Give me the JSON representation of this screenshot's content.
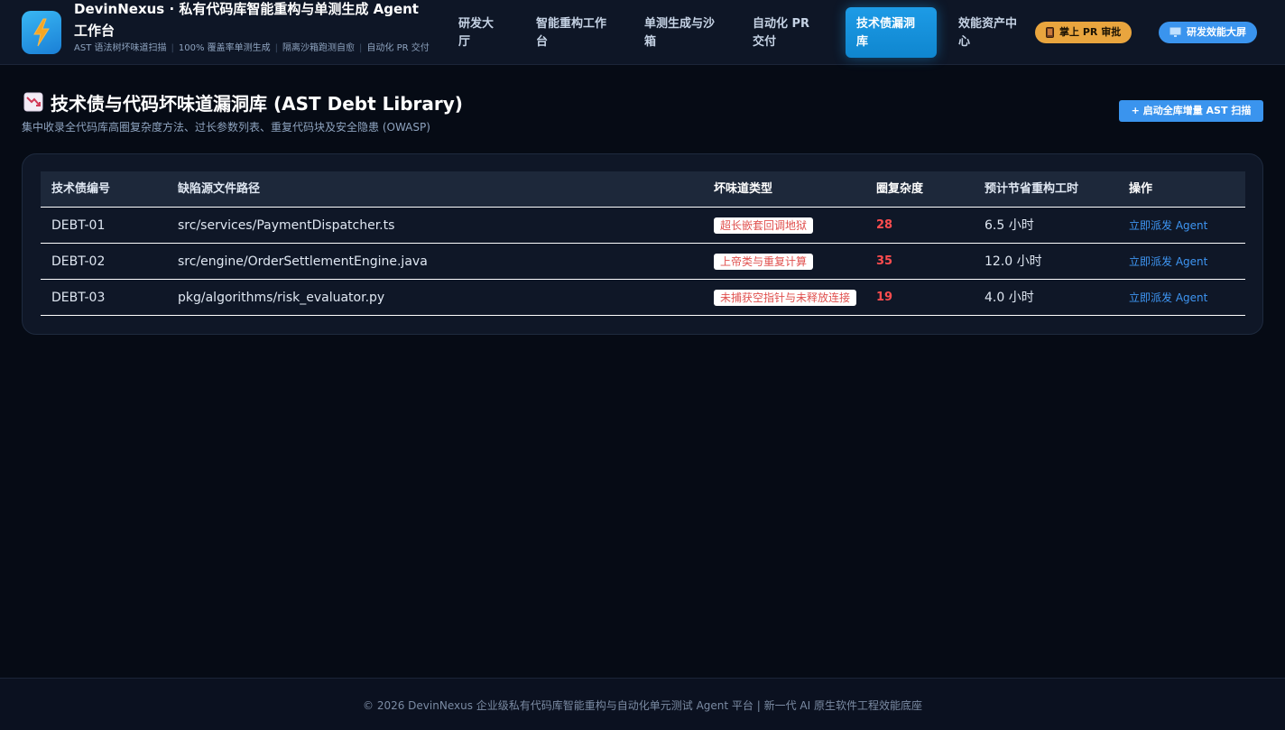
{
  "app": {
    "title": "DevinNexus · 私有代码库智能重构与单测生成 Agent 工作台",
    "subtitle_parts": [
      "AST 语法树坏味道扫描",
      "100% 覆盖率单测生成",
      "隔离沙箱跑测自愈",
      "自动化 PR 交付"
    ],
    "logo_icon": "lightning-icon"
  },
  "nav": {
    "items": [
      {
        "label": "研发大厅",
        "active": false
      },
      {
        "label": "智能重构工作台",
        "active": false
      },
      {
        "label": "单测生成与沙箱",
        "active": false
      },
      {
        "label": "自动化 PR 交付",
        "active": false
      },
      {
        "label": "技术债漏洞库",
        "active": true
      },
      {
        "label": "效能资产中心",
        "active": false
      }
    ],
    "mobile_review": {
      "label": "掌上 PR 审批",
      "icon": "phone-icon"
    },
    "dashboard": {
      "label": "研发效能大屏",
      "icon": "monitor-icon"
    }
  },
  "page": {
    "title": "技术债与代码坏味道漏洞库 (AST Debt Library)",
    "title_icon": "chart-down-icon",
    "subtitle": "集中收录全代码库高圈复杂度方法、过长参数列表、重复代码块及安全隐患 (OWASP)",
    "scan_button": "+ 启动全库增量 AST 扫描"
  },
  "table": {
    "columns": [
      "技术债编号",
      "缺陷源文件路径",
      "坏味道类型",
      "圈复杂度",
      "预计节省重构工时",
      "操作"
    ],
    "rows": [
      {
        "id": "DEBT-01",
        "path": "src/services/PaymentDispatcher.ts",
        "smell": "超长嵌套回调地狱",
        "complexity": "28",
        "hours": "6.5 小时",
        "action": "立即派发 Agent"
      },
      {
        "id": "DEBT-02",
        "path": "src/engine/OrderSettlementEngine.java",
        "smell": "上帝类与重复计算",
        "complexity": "35",
        "hours": "12.0 小时",
        "action": "立即派发 Agent"
      },
      {
        "id": "DEBT-03",
        "path": "pkg/algorithms/risk_evaluator.py",
        "smell": "未捕获空指针与未释放连接",
        "complexity": "19",
        "hours": "4.0 小时",
        "action": "立即派发 Agent"
      }
    ]
  },
  "footer": {
    "text": "© 2026 DevinNexus 企业级私有代码库智能重构与自动化单元测试 Agent 平台 | 新一代 AI 原生软件工程效能底座"
  },
  "colors": {
    "accent": "#1d9be6",
    "danger": "#ff4d4f",
    "warning": "#e9a53e",
    "background": "#060b15"
  }
}
